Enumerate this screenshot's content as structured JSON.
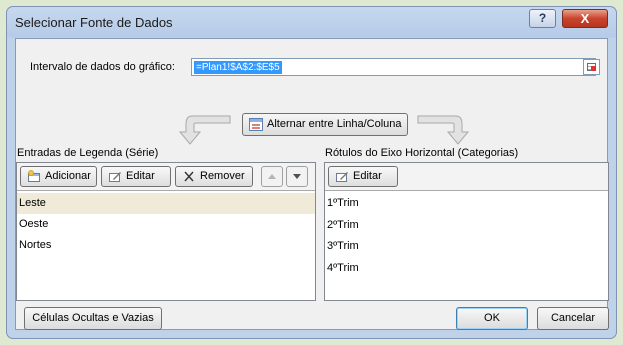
{
  "dialog": {
    "title": "Selecionar Fonte de Dados",
    "help_label": "?",
    "close_label": "X"
  },
  "range": {
    "label": "Intervalo de dados do gráfico:",
    "value": "=Plan1!$A$2:$E$5"
  },
  "switch_button": "Alternar entre Linha/Coluna",
  "legend": {
    "label": "Entradas de Legenda (Série)",
    "add_label": "Adicionar",
    "edit_label": "Editar",
    "remove_label": "Remover",
    "items": [
      "Leste",
      "Oeste",
      "Nortes"
    ]
  },
  "axis": {
    "label": "Rótulos do Eixo Horizontal (Categorias)",
    "edit_label": "Editar",
    "items": [
      "1ºTrim",
      "2ºTrim",
      "3ºTrim",
      "4ºTrim"
    ]
  },
  "hidden_cells_button": "Células Ocultas e Vazias",
  "ok_button": "OK",
  "cancel_button": "Cancelar"
}
